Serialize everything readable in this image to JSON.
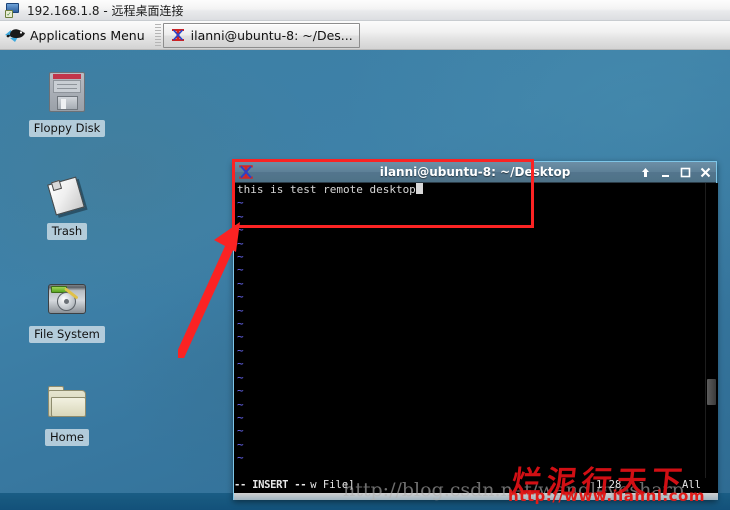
{
  "rdp": {
    "title": "192.168.1.8 - 远程桌面连接",
    "icon": "remote-desktop-icon"
  },
  "panel": {
    "apps_menu": {
      "label": "Applications Menu",
      "icon": "xfce-mouse-icon"
    },
    "task_button": {
      "label": "ilanni@ubuntu-8: ~/Des...",
      "icon": "xterm-icon"
    }
  },
  "desktop": {
    "icons": [
      {
        "label": "Floppy Disk",
        "icon": "floppy-disk-icon"
      },
      {
        "label": "Trash",
        "icon": "trash-icon"
      },
      {
        "label": "File System",
        "icon": "hard-disk-icon"
      },
      {
        "label": "Home",
        "icon": "folder-icon"
      }
    ]
  },
  "terminal": {
    "title": "ilanni@ubuntu-8: ~/Desktop",
    "icon": "xterm-icon",
    "buttons": [
      {
        "name": "shade-button",
        "label": "shade-up-icon"
      },
      {
        "name": "minimize-button",
        "label": "minimize-icon"
      },
      {
        "name": "maximize-button",
        "label": "maximize-icon"
      },
      {
        "name": "close-button",
        "label": "close-icon"
      }
    ],
    "editor": {
      "first_line": "this is test remote desktop",
      "tilde": "~",
      "tilde_line_count": 20,
      "status": {
        "mode": "-- INSERT --",
        "file": "w File]",
        "position": "1,28",
        "scroll": "All"
      }
    }
  },
  "watermarks": {
    "chinese": "烂泥行天下",
    "blog": "http://blog.csdn.net/wangleyesharp",
    "site": "http://www.ilanni.com"
  },
  "annotations": {
    "rect_name": "red-highlight-rectangle",
    "arrow_name": "red-pointer-arrow",
    "color": "#fb2323"
  }
}
